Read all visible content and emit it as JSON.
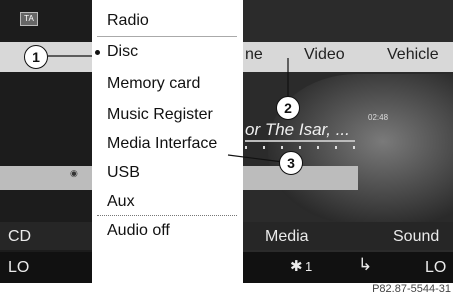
{
  "status_badge": "TA",
  "nav_tabs": [
    "ne",
    "Video",
    "Vehicle"
  ],
  "track_text": "or The Isar, ...",
  "time": "02:48",
  "menu": {
    "items": [
      "Radio",
      "Disc",
      "Memory card",
      "Music Register",
      "Media Interface",
      "USB",
      "Aux",
      "Audio off"
    ],
    "selected": "Disc"
  },
  "bottom_bar": {
    "left_label": "CD",
    "center_label": "Media",
    "right_label": "Sound"
  },
  "lower_bar": {
    "left": "LO",
    "fan": "1",
    "right": "LO"
  },
  "callouts": [
    "1",
    "2",
    "3"
  ],
  "figure_code": "P82.87-5544-31",
  "colors": {
    "screen_dark": "#1a1a1a",
    "highlight_bar": "#bcbcbc",
    "menu_bg": "#ffffff"
  },
  "icons": [
    "disc-icon",
    "fan-icon",
    "seat-icon"
  ]
}
